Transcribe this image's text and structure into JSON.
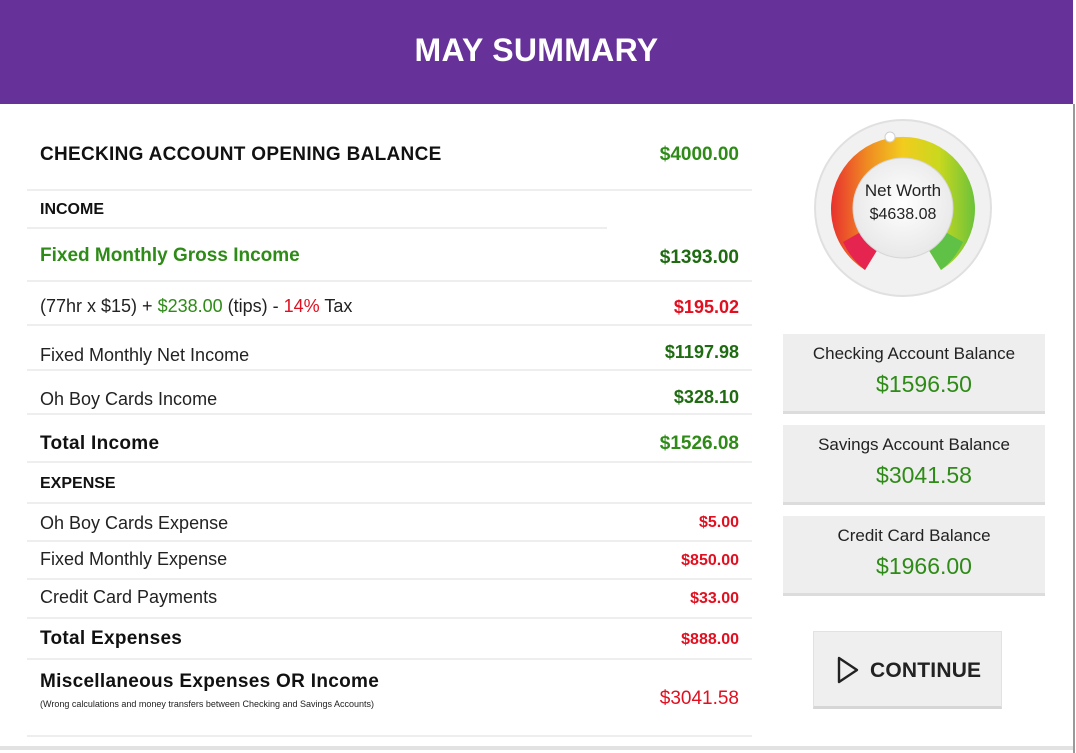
{
  "header": {
    "title": "MAY SUMMARY"
  },
  "opening": {
    "label": "CHECKING ACCOUNT OPENING BALANCE",
    "value": "$4000.00"
  },
  "income": {
    "section_label": "INCOME",
    "gross": {
      "label": "Fixed Monthly Gross Income",
      "value": "$1393.00"
    },
    "tax_line": {
      "part1": "(77hr x $15) + ",
      "tips": "$238.00",
      "part2": " (tips) - ",
      "tax_rate": "14%",
      "part3": " Tax",
      "value": "$195.02"
    },
    "net": {
      "label": "Fixed Monthly Net Income",
      "value": "$1197.98"
    },
    "cards": {
      "label": "Oh Boy Cards Income",
      "value": "$328.10"
    },
    "total": {
      "label": "Total Income",
      "value": "$1526.08"
    }
  },
  "expense": {
    "section_label": "EXPENSE",
    "cards": {
      "label": "Oh Boy Cards Expense",
      "value": "$5.00"
    },
    "fixed": {
      "label": "Fixed Monthly Expense",
      "value": "$850.00"
    },
    "credit": {
      "label": "Credit Card Payments",
      "value": "$33.00"
    },
    "total": {
      "label": "Total Expenses",
      "value": "$888.00"
    }
  },
  "misc": {
    "label": "Miscellaneous Expenses OR Income",
    "note": "(Wrong calculations and money transfers between Checking and Savings Accounts)",
    "value": "$3041.58"
  },
  "gauge": {
    "label": "Net Worth",
    "value": "$4638.08"
  },
  "balances": {
    "checking": {
      "label": "Checking Account Balance",
      "value": "$1596.50"
    },
    "savings": {
      "label": "Savings Account Balance",
      "value": "$3041.58"
    },
    "credit": {
      "label": "Credit Card Balance",
      "value": "$1966.00"
    }
  },
  "continue_button": {
    "label": "CONTINUE",
    "icon": "play-outline-icon"
  },
  "colors": {
    "header": "#66329a",
    "positive": "#2e8b17",
    "negative": "#e10f1f"
  }
}
